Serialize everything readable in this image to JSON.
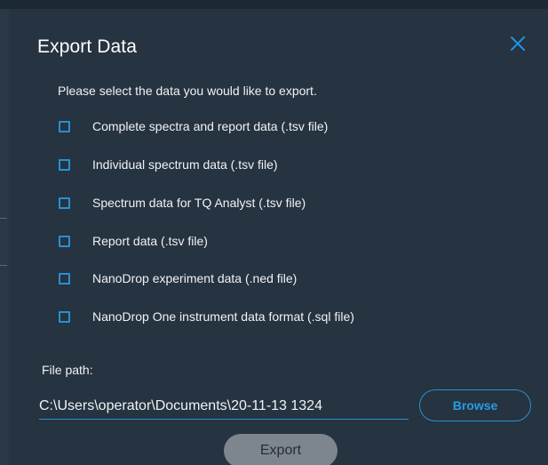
{
  "dialog": {
    "title": "Export Data",
    "prompt": "Please select the data you would like to export.",
    "options": [
      {
        "label": "Complete spectra and report data (.tsv file)",
        "checked": false
      },
      {
        "label": "Individual spectrum data (.tsv file)",
        "checked": false
      },
      {
        "label": "Spectrum data for TQ Analyst (.tsv file)",
        "checked": false
      },
      {
        "label": "Report data (.tsv file)",
        "checked": false
      },
      {
        "label": "NanoDrop experiment data (.ned file)",
        "checked": false
      },
      {
        "label": "NanoDrop One instrument data format (.sql file)",
        "checked": false
      }
    ],
    "file_path_label": "File path:",
    "file_path_value": "C:\\Users\\operator\\Documents\\20-11-13 1324",
    "browse_label": "Browse",
    "export_label": "Export"
  },
  "colors": {
    "background": "#263340",
    "accent": "#2a8fd3",
    "close_icon": "#1c97e6",
    "export_disabled": "#7d858d"
  }
}
